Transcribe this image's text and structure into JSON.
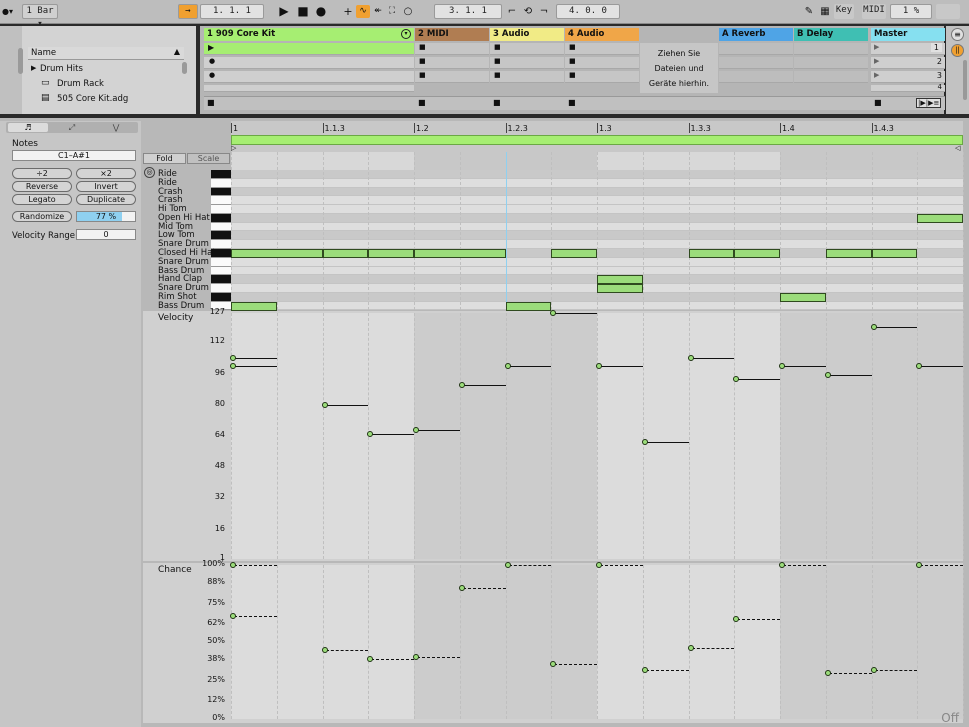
{
  "transport": {
    "quantize": "1 Bar",
    "position": "1.  1.  1",
    "loop_start": "3.  1.  1",
    "loop_length": "4.  0.  0",
    "key_label": "Key",
    "midi_label": "MIDI",
    "cpu": "1 %"
  },
  "browser": {
    "header": "Name",
    "items": [
      "Drum Hits",
      "Drum Rack",
      "505 Core Kit.adg"
    ]
  },
  "tracks": [
    {
      "name": "1 909 Core Kit",
      "color": "#a6ee72"
    },
    {
      "name": "2 MIDI",
      "color": "#b07d52"
    },
    {
      "name": "3 Audio",
      "color": "#f1eb86"
    },
    {
      "name": "4 Audio",
      "color": "#f0a648"
    },
    {
      "name": "A Reverb",
      "color": "#4fa4e6"
    },
    {
      "name": "B Delay",
      "color": "#3fbfb3"
    },
    {
      "name": "Master",
      "color": "#86e0f0"
    }
  ],
  "drop_hint": [
    "Ziehen Sie",
    "Dateien und",
    "Geräte hierhin."
  ],
  "scenes": [
    "1",
    "2",
    "3",
    "4"
  ],
  "clip_panel": {
    "title": "Notes",
    "range": "C1–A#1",
    "half": "÷2",
    "double": "×2",
    "reverse": "Reverse",
    "invert": "Invert",
    "legato": "Legato",
    "duplicate": "Duplicate",
    "randomize": "Randomize",
    "randomize_value": "77 %",
    "velocity_range_label": "Velocity Range",
    "velocity_range_value": "0"
  },
  "editor": {
    "fold": "Fold",
    "scale": "Scale",
    "ruler": [
      "1",
      "1.1.3",
      "1.2",
      "1.2.3",
      "1.3",
      "1.3.3",
      "1.4",
      "1.4.3"
    ],
    "rows": [
      "Ride",
      "Ride",
      "Crash",
      "Crash",
      "Hi Tom",
      "Open Hi Hat",
      "Mid Tom",
      "Low Tom",
      "Snare Drum",
      "Closed Hi Hat",
      "Snare Drum",
      "Bass Drum",
      "Hand Clap",
      "Snare Drum",
      "Rim Shot",
      "Bass Drum"
    ],
    "velocity_label": "Velocity",
    "velocity_ticks": [
      "127",
      "112",
      "96",
      "80",
      "64",
      "48",
      "32",
      "16",
      "1"
    ],
    "chance_label": "Chance",
    "chance_ticks": [
      "100%",
      "88%",
      "75%",
      "62%",
      "50%",
      "38%",
      "25%",
      "12%",
      "0%"
    ],
    "off_label": "Off"
  },
  "notes": [
    {
      "row": 15,
      "start": 0,
      "len": 0.5
    },
    {
      "row": 9,
      "start": 0,
      "len": 1
    },
    {
      "row": 9,
      "start": 1,
      "len": 0.5
    },
    {
      "row": 9,
      "start": 1.5,
      "len": 0.5
    },
    {
      "row": 9,
      "start": 2,
      "len": 1
    },
    {
      "row": 15,
      "start": 3,
      "len": 0.5
    },
    {
      "row": 9,
      "start": 3.5,
      "len": 0.5
    },
    {
      "row": 12,
      "start": 4,
      "len": 0.5
    },
    {
      "row": 13,
      "start": 4,
      "len": 0.5
    },
    {
      "row": 9,
      "start": 5,
      "len": 0.5
    },
    {
      "row": 9,
      "start": 5.5,
      "len": 0.5
    },
    {
      "row": 14,
      "start": 6,
      "len": 0.5
    },
    {
      "row": 9,
      "start": 6.5,
      "len": 0.5
    },
    {
      "row": 9,
      "start": 7,
      "len": 0.5
    },
    {
      "row": 5,
      "start": 7.5,
      "len": 0.5
    }
  ],
  "velocities": [
    {
      "start": 0,
      "len": 0.5,
      "value": 104
    },
    {
      "start": 0,
      "len": 0.5,
      "value": 100
    },
    {
      "start": 1,
      "len": 0.5,
      "value": 80
    },
    {
      "start": 1.5,
      "len": 0.5,
      "value": 65
    },
    {
      "start": 2,
      "len": 0.5,
      "value": 67
    },
    {
      "start": 2.5,
      "len": 0.5,
      "value": 90
    },
    {
      "start": 3,
      "len": 0.5,
      "value": 100
    },
    {
      "start": 3.5,
      "len": 0.5,
      "value": 127
    },
    {
      "start": 4,
      "len": 0.5,
      "value": 100
    },
    {
      "start": 4.5,
      "len": 0.5,
      "value": 61
    },
    {
      "start": 5,
      "len": 0.5,
      "value": 104
    },
    {
      "start": 5.5,
      "len": 0.5,
      "value": 93
    },
    {
      "start": 6,
      "len": 0.5,
      "value": 100
    },
    {
      "start": 6.5,
      "len": 0.5,
      "value": 95
    },
    {
      "start": 7,
      "len": 0.5,
      "value": 120
    },
    {
      "start": 7.5,
      "len": 0.5,
      "value": 100
    }
  ],
  "chances": [
    {
      "start": 0,
      "len": 0.5,
      "value": 100
    },
    {
      "start": 0,
      "len": 0.5,
      "value": 67
    },
    {
      "start": 1,
      "len": 0.5,
      "value": 45
    },
    {
      "start": 1.5,
      "len": 0.5,
      "value": 39
    },
    {
      "start": 2,
      "len": 0.5,
      "value": 40
    },
    {
      "start": 2.5,
      "len": 0.5,
      "value": 85
    },
    {
      "start": 3,
      "len": 0.5,
      "value": 100
    },
    {
      "start": 3.5,
      "len": 0.5,
      "value": 36
    },
    {
      "start": 4,
      "len": 0.5,
      "value": 100
    },
    {
      "start": 4.5,
      "len": 0.5,
      "value": 32
    },
    {
      "start": 5,
      "len": 0.5,
      "value": 46
    },
    {
      "start": 5.5,
      "len": 0.5,
      "value": 65
    },
    {
      "start": 6,
      "len": 0.5,
      "value": 100
    },
    {
      "start": 6.5,
      "len": 0.5,
      "value": 30
    },
    {
      "start": 7,
      "len": 0.5,
      "value": 32
    },
    {
      "start": 7.5,
      "len": 0.5,
      "value": 100
    }
  ]
}
